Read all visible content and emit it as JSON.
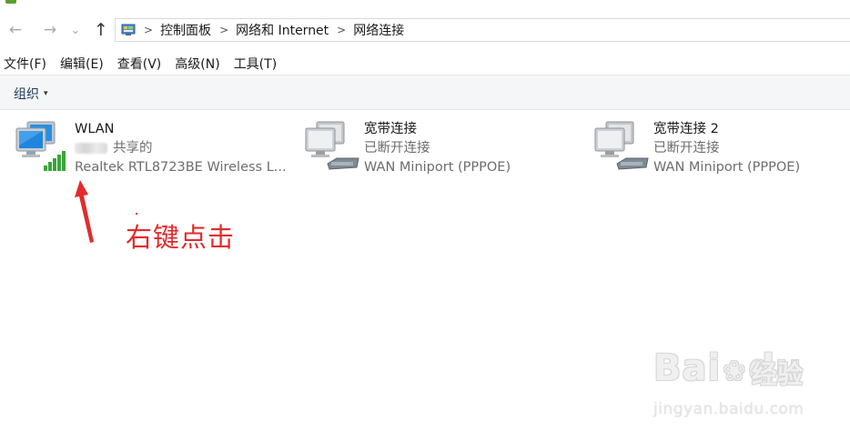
{
  "nav": {
    "back_glyph": "←",
    "forward_glyph": "→",
    "recent_glyph": "⌄",
    "up_glyph": "↑"
  },
  "address": {
    "icon": "control-panel-icon",
    "separator": ">",
    "crumbs": [
      "控制面板",
      "网络和 Internet",
      "网络连接"
    ]
  },
  "menu": [
    "文件(F)",
    "编辑(E)",
    "查看(V)",
    "高级(N)",
    "工具(T)"
  ],
  "toolbar": {
    "organize_label": "组织",
    "organize_caret": "▾"
  },
  "connections": [
    {
      "name": "WLAN",
      "status": "共享的",
      "device": "Realtek RTL8723BE Wireless L...",
      "icon": "wifi-network-icon",
      "signal_color": "#3aa53a"
    },
    {
      "name": "宽带连接",
      "status": "已断开连接",
      "device": "WAN Miniport (PPPOE)",
      "icon": "broadband-modem-icon"
    },
    {
      "name": "宽带连接 2",
      "status": "已断开连接",
      "device": "WAN Miniport (PPPOE)",
      "icon": "broadband-modem-icon"
    }
  ],
  "annotation": {
    "text": "右键点击",
    "color": "#e32b2b"
  },
  "watermark": {
    "brand": "Bai",
    "brand2": "du",
    "cn": "经验",
    "url": "jingyan.baidu.com"
  }
}
